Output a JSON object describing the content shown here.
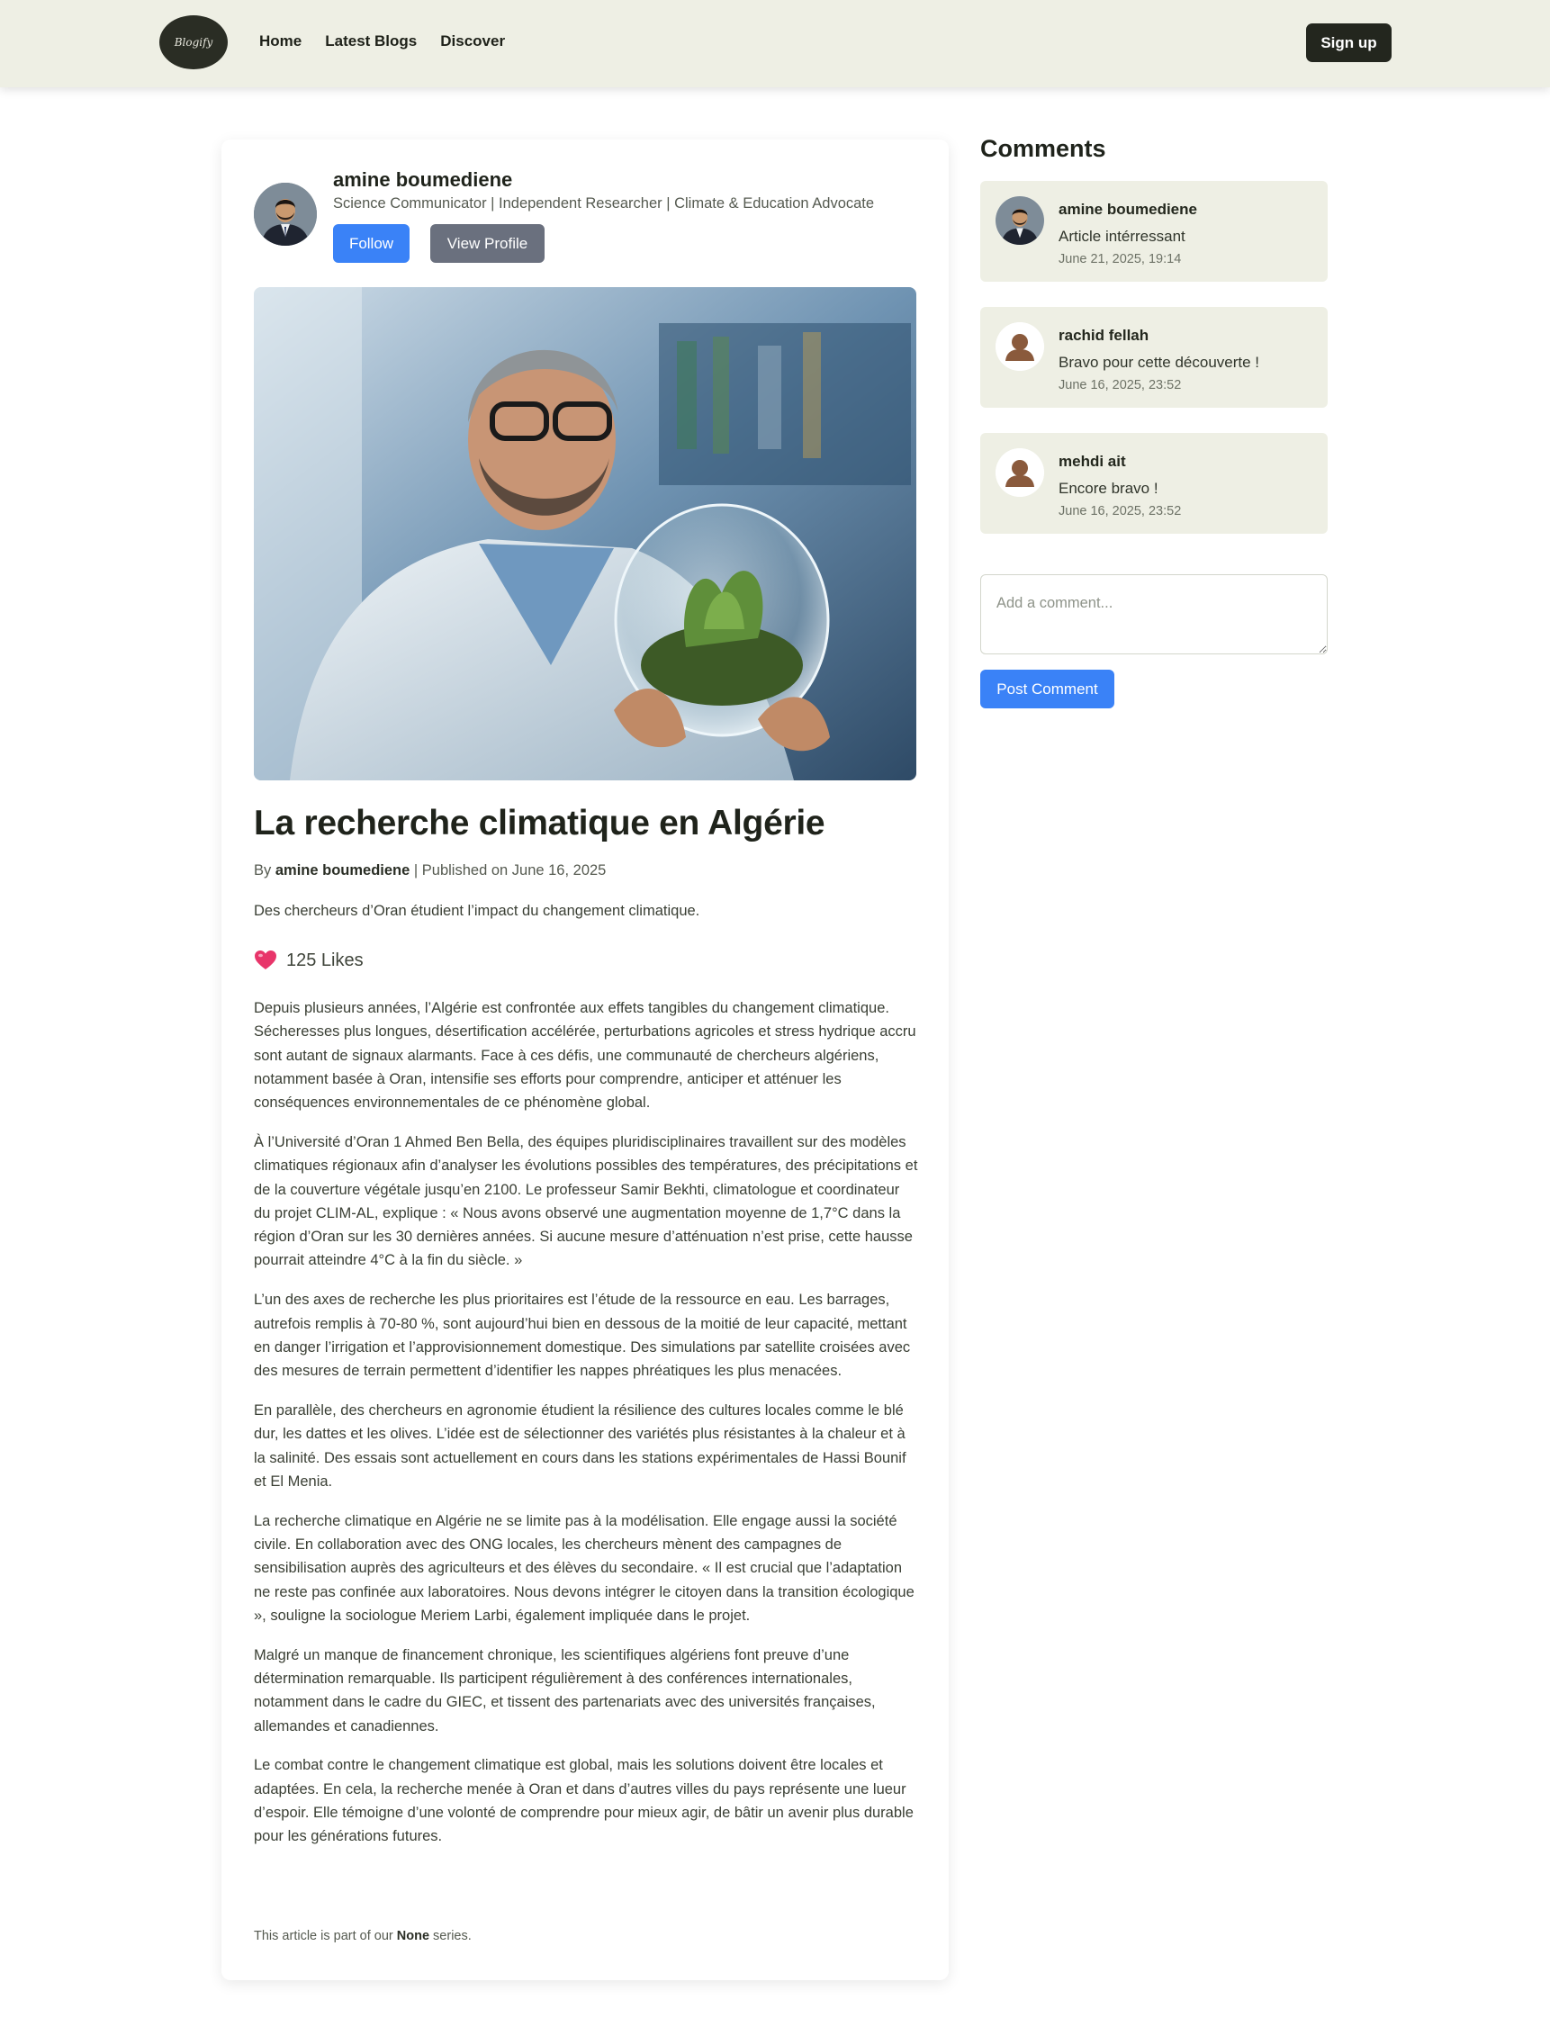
{
  "nav": {
    "logo_text": "Blogify",
    "links": [
      {
        "label": "Home"
      },
      {
        "label": "Latest Blogs"
      },
      {
        "label": "Discover"
      }
    ],
    "signup_label": "Sign up"
  },
  "author": {
    "name": "amine boumediene",
    "bio": "Science Communicator | Independent Researcher | Climate & Education Advocate",
    "follow_label": "Follow",
    "view_profile_label": "View Profile"
  },
  "article": {
    "title": "La recherche climatique en Algérie",
    "by_prefix": "By",
    "author": "amine boumediene",
    "published": "| Published on June 16, 2025",
    "summary": "Des chercheurs d’Oran étudient l’impact du changement climatique.",
    "likes": "125 Likes",
    "paragraphs": [
      "Depuis plusieurs années, l’Algérie est confrontée aux effets tangibles du changement climatique. Sécheresses plus longues, désertification accélérée, perturbations agricoles et stress hydrique accru sont autant de signaux alarmants. Face à ces défis, une communauté de chercheurs algériens, notamment basée à Oran, intensifie ses efforts pour comprendre, anticiper et atténuer les conséquences environnementales de ce phénomène global.",
      "À l’Université d’Oran 1 Ahmed Ben Bella, des équipes pluridisciplinaires travaillent sur des modèles climatiques régionaux afin d’analyser les évolutions possibles des températures, des précipitations et de la couverture végétale jusqu’en 2100. Le professeur Samir Bekhti, climatologue et coordinateur du projet CLIM-AL, explique : « Nous avons observé une augmentation moyenne de 1,7°C dans la région d’Oran sur les 30 dernières années. Si aucune mesure d’atténuation n’est prise, cette hausse pourrait atteindre 4°C à la fin du siècle. »",
      "L’un des axes de recherche les plus prioritaires est l’étude de la ressource en eau. Les barrages, autrefois remplis à 70-80 %, sont aujourd’hui bien en dessous de la moitié de leur capacité, mettant en danger l’irrigation et l’approvisionnement domestique. Des simulations par satellite croisées avec des mesures de terrain permettent d’identifier les nappes phréatiques les plus menacées.",
      "En parallèle, des chercheurs en agronomie étudient la résilience des cultures locales comme le blé dur, les dattes et les olives. L’idée est de sélectionner des variétés plus résistantes à la chaleur et à la salinité. Des essais sont actuellement en cours dans les stations expérimentales de Hassi Bounif et El Menia.",
      "La recherche climatique en Algérie ne se limite pas à la modélisation. Elle engage aussi la société civile. En collaboration avec des ONG locales, les chercheurs mènent des campagnes de sensibilisation auprès des agriculteurs et des élèves du secondaire. « Il est crucial que l’adaptation ne reste pas confinée aux laboratoires. Nous devons intégrer le citoyen dans la transition écologique », souligne la sociologue Meriem Larbi, également impliquée dans le projet.",
      "Malgré un manque de financement chronique, les scientifiques algériens font preuve d’une détermination remarquable. Ils participent régulièrement à des conférences internationales, notamment dans le cadre du GIEC, et tissent des partenariats avec des universités françaises, allemandes et canadiennes.",
      "Le combat contre le changement climatique est global, mais les solutions doivent être locales et adaptées. En cela, la recherche menée à Oran et dans d’autres villes du pays représente une lueur d’espoir. Elle témoigne d’une volonté de comprendre pour mieux agir, de bâtir un avenir plus durable pour les générations futures."
    ],
    "series_prefix": "This article is part of our",
    "series_name": "None",
    "series_suffix": "series."
  },
  "comments": {
    "heading": "Comments",
    "items": [
      {
        "author": "amine boumediene",
        "text": "Article intérressant",
        "date": "June 21, 2025, 19:14",
        "avatar": "photo"
      },
      {
        "author": "rachid fellah",
        "text": "Bravo pour cette découverte !",
        "date": "June 16, 2025, 23:52",
        "avatar": "default-user-icon"
      },
      {
        "author": "mehdi ait",
        "text": "Encore bravo !",
        "date": "June 16, 2025, 23:52",
        "avatar": "default-user-icon"
      }
    ],
    "input_placeholder": "Add a comment...",
    "post_label": "Post Comment"
  },
  "colors": {
    "navbar_bg": "#eeefe4",
    "primary_button": "#3a82f7",
    "secondary_button": "#6a707e",
    "dark_button": "#23261e",
    "comment_bg": "#eeefe4",
    "heart": "#e8356a"
  }
}
